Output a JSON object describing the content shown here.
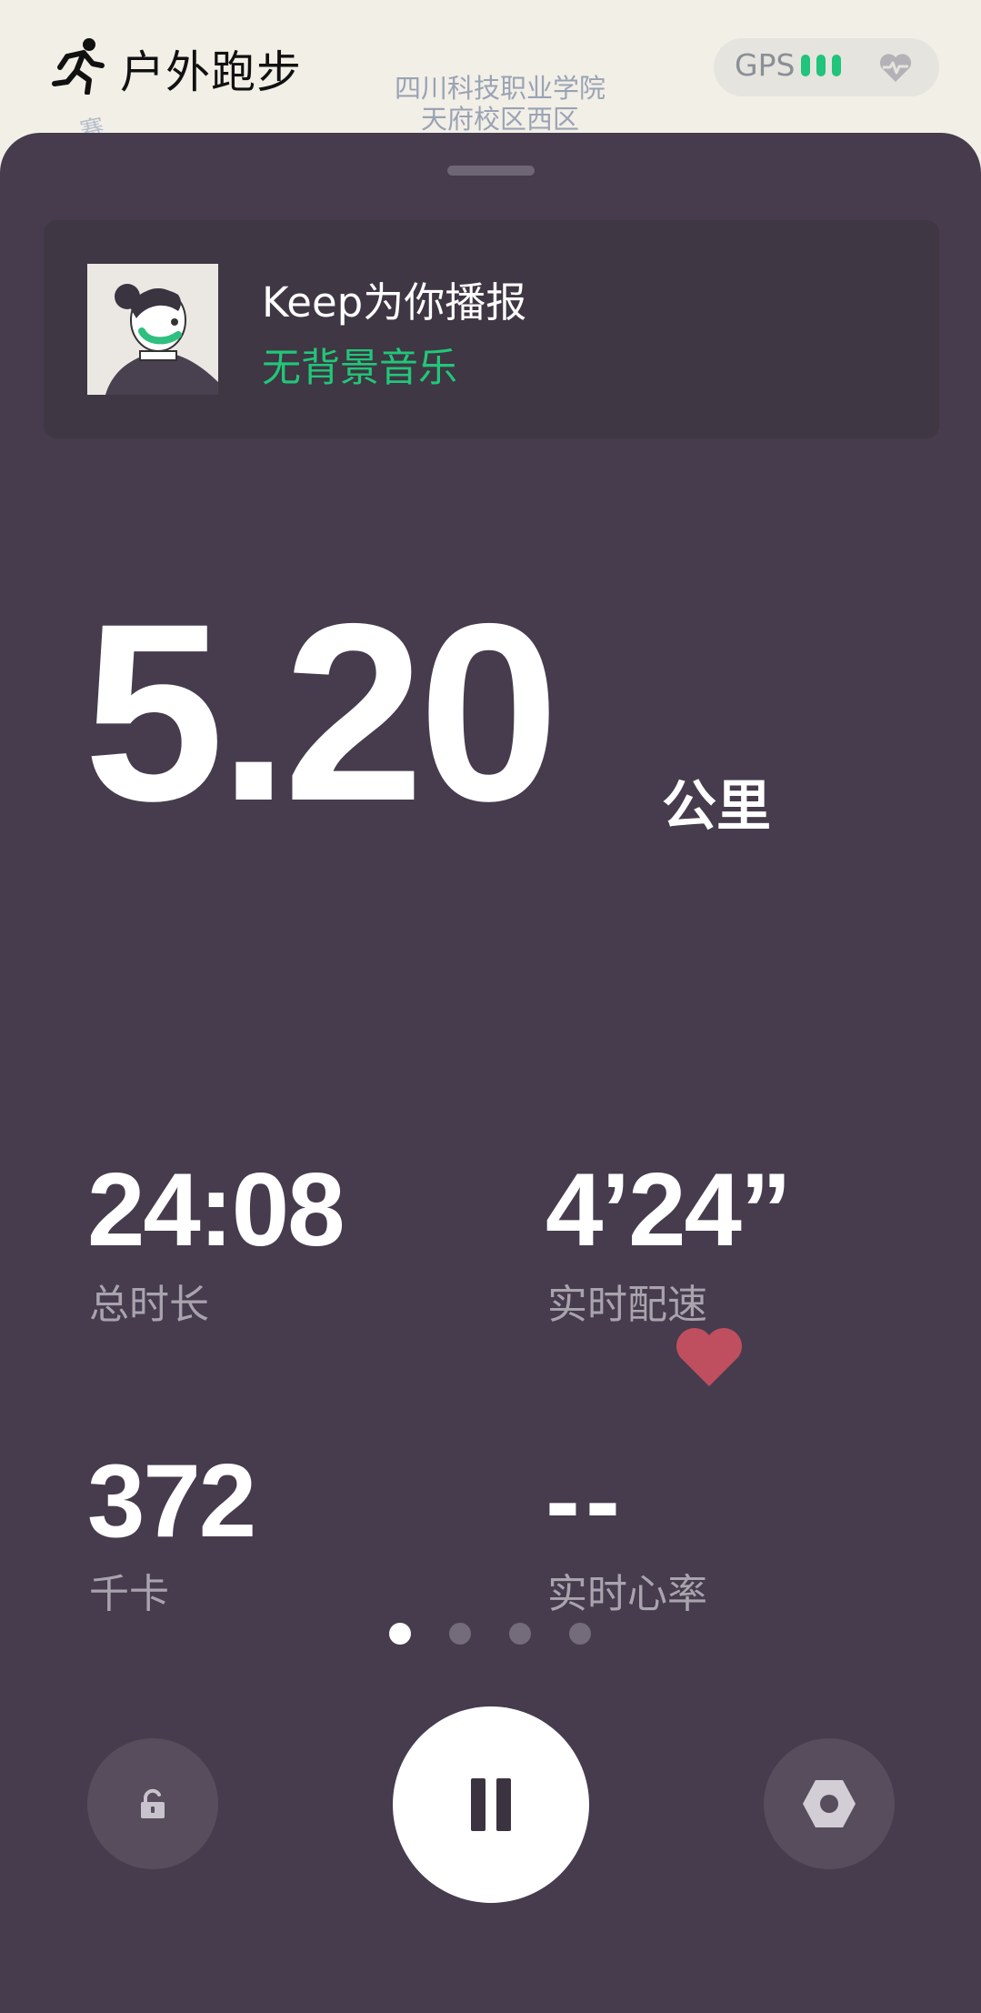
{
  "map": {
    "place_line1": "四川科技职业学院",
    "place_line2": "天府校区西区",
    "road_char": "赛"
  },
  "header": {
    "title": "户外跑步",
    "run_icon": "running-person-icon",
    "gps_label": "GPS",
    "gps_signal_bars": 3,
    "heart_rate_icon": "heart-rate-icon",
    "accent_color": "#20c47a"
  },
  "broadcast": {
    "title": "Keep为你播报",
    "subtitle": "无背景音乐",
    "avatar_icon": "voice-coach-avatar"
  },
  "run": {
    "distance": "5.20",
    "distance_unit": "公里",
    "duration": "24:08",
    "duration_label": "总时长",
    "pace": "4’24”",
    "pace_label": "实时配速",
    "calories": "372",
    "calories_label": "千卡",
    "heart_rate": "--",
    "heart_rate_label": "实时心率"
  },
  "pager": {
    "pages": 4,
    "active": 1
  },
  "controls": {
    "lock_icon": "unlock-icon",
    "pause_icon": "pause-icon",
    "settings_icon": "hexagon-settings-icon"
  },
  "colors": {
    "panel_bg": "#463c4d",
    "card_bg": "#3f3743",
    "green": "#21c779",
    "heart": "#c0505e"
  }
}
